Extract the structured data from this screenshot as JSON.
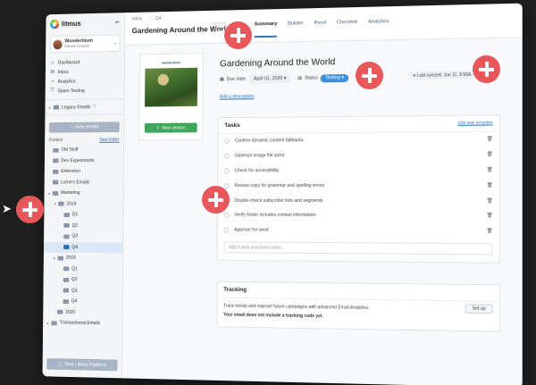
{
  "app": {
    "logo_text": "litmus"
  },
  "account": {
    "name": "Wonderbium",
    "role": "Parent Account"
  },
  "nav": [
    {
      "label": "Dashboard",
      "icon": "home-icon",
      "glyph": "⌂"
    },
    {
      "label": "Inbox",
      "icon": "inbox-icon",
      "glyph": "✉"
    },
    {
      "label": "Analytics",
      "icon": "analytics-icon",
      "glyph": "◔"
    },
    {
      "label": "Spam Testing",
      "icon": "shield-icon",
      "glyph": "⛉"
    }
  ],
  "legacy_emails": "Legacy Emails",
  "view_emails": "→ View emails",
  "folders": {
    "title": "Folders",
    "new_folder": "New folder"
  },
  "tree": [
    {
      "label": "Old Stuff",
      "depth": 0,
      "caret": "",
      "active": false
    },
    {
      "label": "Dev Experiments",
      "depth": 0,
      "caret": "",
      "active": false
    },
    {
      "label": "Extension",
      "depth": 0,
      "caret": "",
      "active": false
    },
    {
      "label": "Lorne's Emails",
      "depth": 0,
      "caret": "",
      "active": false
    },
    {
      "label": "Marketing",
      "depth": 0,
      "caret": "▾",
      "active": false
    },
    {
      "label": "2019",
      "depth": 1,
      "caret": "▾",
      "active": false
    },
    {
      "label": "Q1",
      "depth": 2,
      "caret": "",
      "active": false
    },
    {
      "label": "Q2",
      "depth": 2,
      "caret": "",
      "active": false
    },
    {
      "label": "Q3",
      "depth": 2,
      "caret": "",
      "active": false
    },
    {
      "label": "Q4",
      "depth": 2,
      "caret": "",
      "active": true
    },
    {
      "label": "2018",
      "depth": 1,
      "caret": "▾",
      "active": false
    },
    {
      "label": "Q1",
      "depth": 2,
      "caret": "",
      "active": false
    },
    {
      "label": "Q2",
      "depth": 2,
      "caret": "",
      "active": false
    },
    {
      "label": "Q3",
      "depth": 2,
      "caret": "",
      "active": false
    },
    {
      "label": "Q4",
      "depth": 2,
      "caret": "",
      "active": false
    },
    {
      "label": "2020",
      "depth": 1,
      "caret": "",
      "active": false
    },
    {
      "label": "Transactional Emails",
      "depth": 0,
      "caret": "▸",
      "active": false
    }
  ],
  "new_platform": "New Litmus Platform",
  "breadcrumb": [
    "Inbox",
    "···",
    "Q4"
  ],
  "email_title": "Gardening Around the World",
  "tabs": [
    {
      "label": "Summary",
      "active": true
    },
    {
      "label": "Builder",
      "active": false
    },
    {
      "label": "Proof",
      "active": false
    },
    {
      "label": "Checklist",
      "active": false
    },
    {
      "label": "Analytics",
      "active": false
    }
  ],
  "preview": {
    "brand": "wonderbium",
    "new_version": "New version"
  },
  "page_title": "Gardening Around the World",
  "meta": {
    "due_label": "Due date:",
    "due_value": "April 01, 2020",
    "status_label": "Status",
    "status_value": "Testing",
    "sync_text": "Last synced: Jun 11, 9:56A"
  },
  "add_description": "Add a description",
  "tasks": {
    "title": "Tasks",
    "edit_link": "Edit task template",
    "items": [
      "Confirm dynamic content fallbacks",
      "Optimize image file sizes",
      "Check for accessibility",
      "Review copy for grammar and spelling errors",
      "Double-check subscriber lists and segments",
      "Verify footer includes contact information",
      "Approve for send"
    ],
    "add_placeholder": "Add a task and press enter..."
  },
  "tracking": {
    "title": "Tracking",
    "body": "Track trends and improve future campaigns with advanced Email Analytics.",
    "warning": "Your email does not include a tracking code yet.",
    "setup_label": "Set up"
  },
  "colors": {
    "accent": "#2a6fb3",
    "hotspot": "#e8575a",
    "status": "#3b8fdc",
    "cta": "#3fa55a"
  }
}
